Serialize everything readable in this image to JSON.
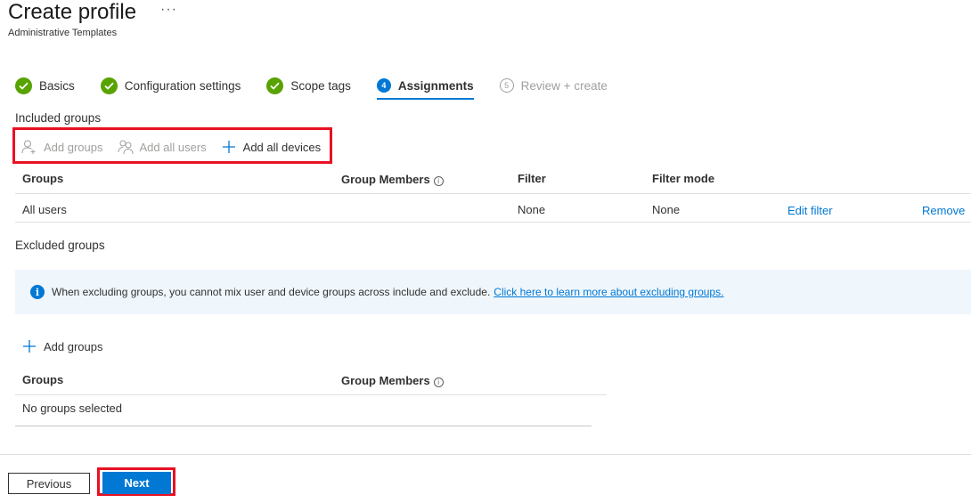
{
  "header": {
    "title": "Create profile",
    "more": "···",
    "subtitle": "Administrative Templates"
  },
  "steps": [
    {
      "label": "Basics",
      "state": "done"
    },
    {
      "label": "Configuration settings",
      "state": "done"
    },
    {
      "label": "Scope tags",
      "state": "done"
    },
    {
      "label": "Assignments",
      "state": "current",
      "number": "4"
    },
    {
      "label": "Review + create",
      "state": "future",
      "number": "5"
    }
  ],
  "included": {
    "section_label": "Included groups",
    "toolbar": {
      "add_groups": "Add groups",
      "add_all_users": "Add all users",
      "add_all_devices": "Add all devices"
    },
    "columns": {
      "groups": "Groups",
      "group_members": "Group Members",
      "filter": "Filter",
      "filter_mode": "Filter mode"
    },
    "rows": [
      {
        "group": "All users",
        "filter": "None",
        "filter_mode": "None",
        "edit_filter": "Edit filter",
        "remove": "Remove"
      }
    ]
  },
  "excluded": {
    "section_label": "Excluded groups",
    "info_text": "When excluding groups, you cannot mix user and device groups across include and exclude.",
    "info_link": "Click here to learn more about excluding groups.",
    "add_groups": "Add groups",
    "columns": {
      "groups": "Groups",
      "group_members": "Group Members"
    },
    "empty_text": "No groups selected"
  },
  "footer": {
    "previous": "Previous",
    "next": "Next"
  },
  "colors": {
    "accent": "#0078d4",
    "success": "#57a300",
    "highlight": "#e81123"
  }
}
